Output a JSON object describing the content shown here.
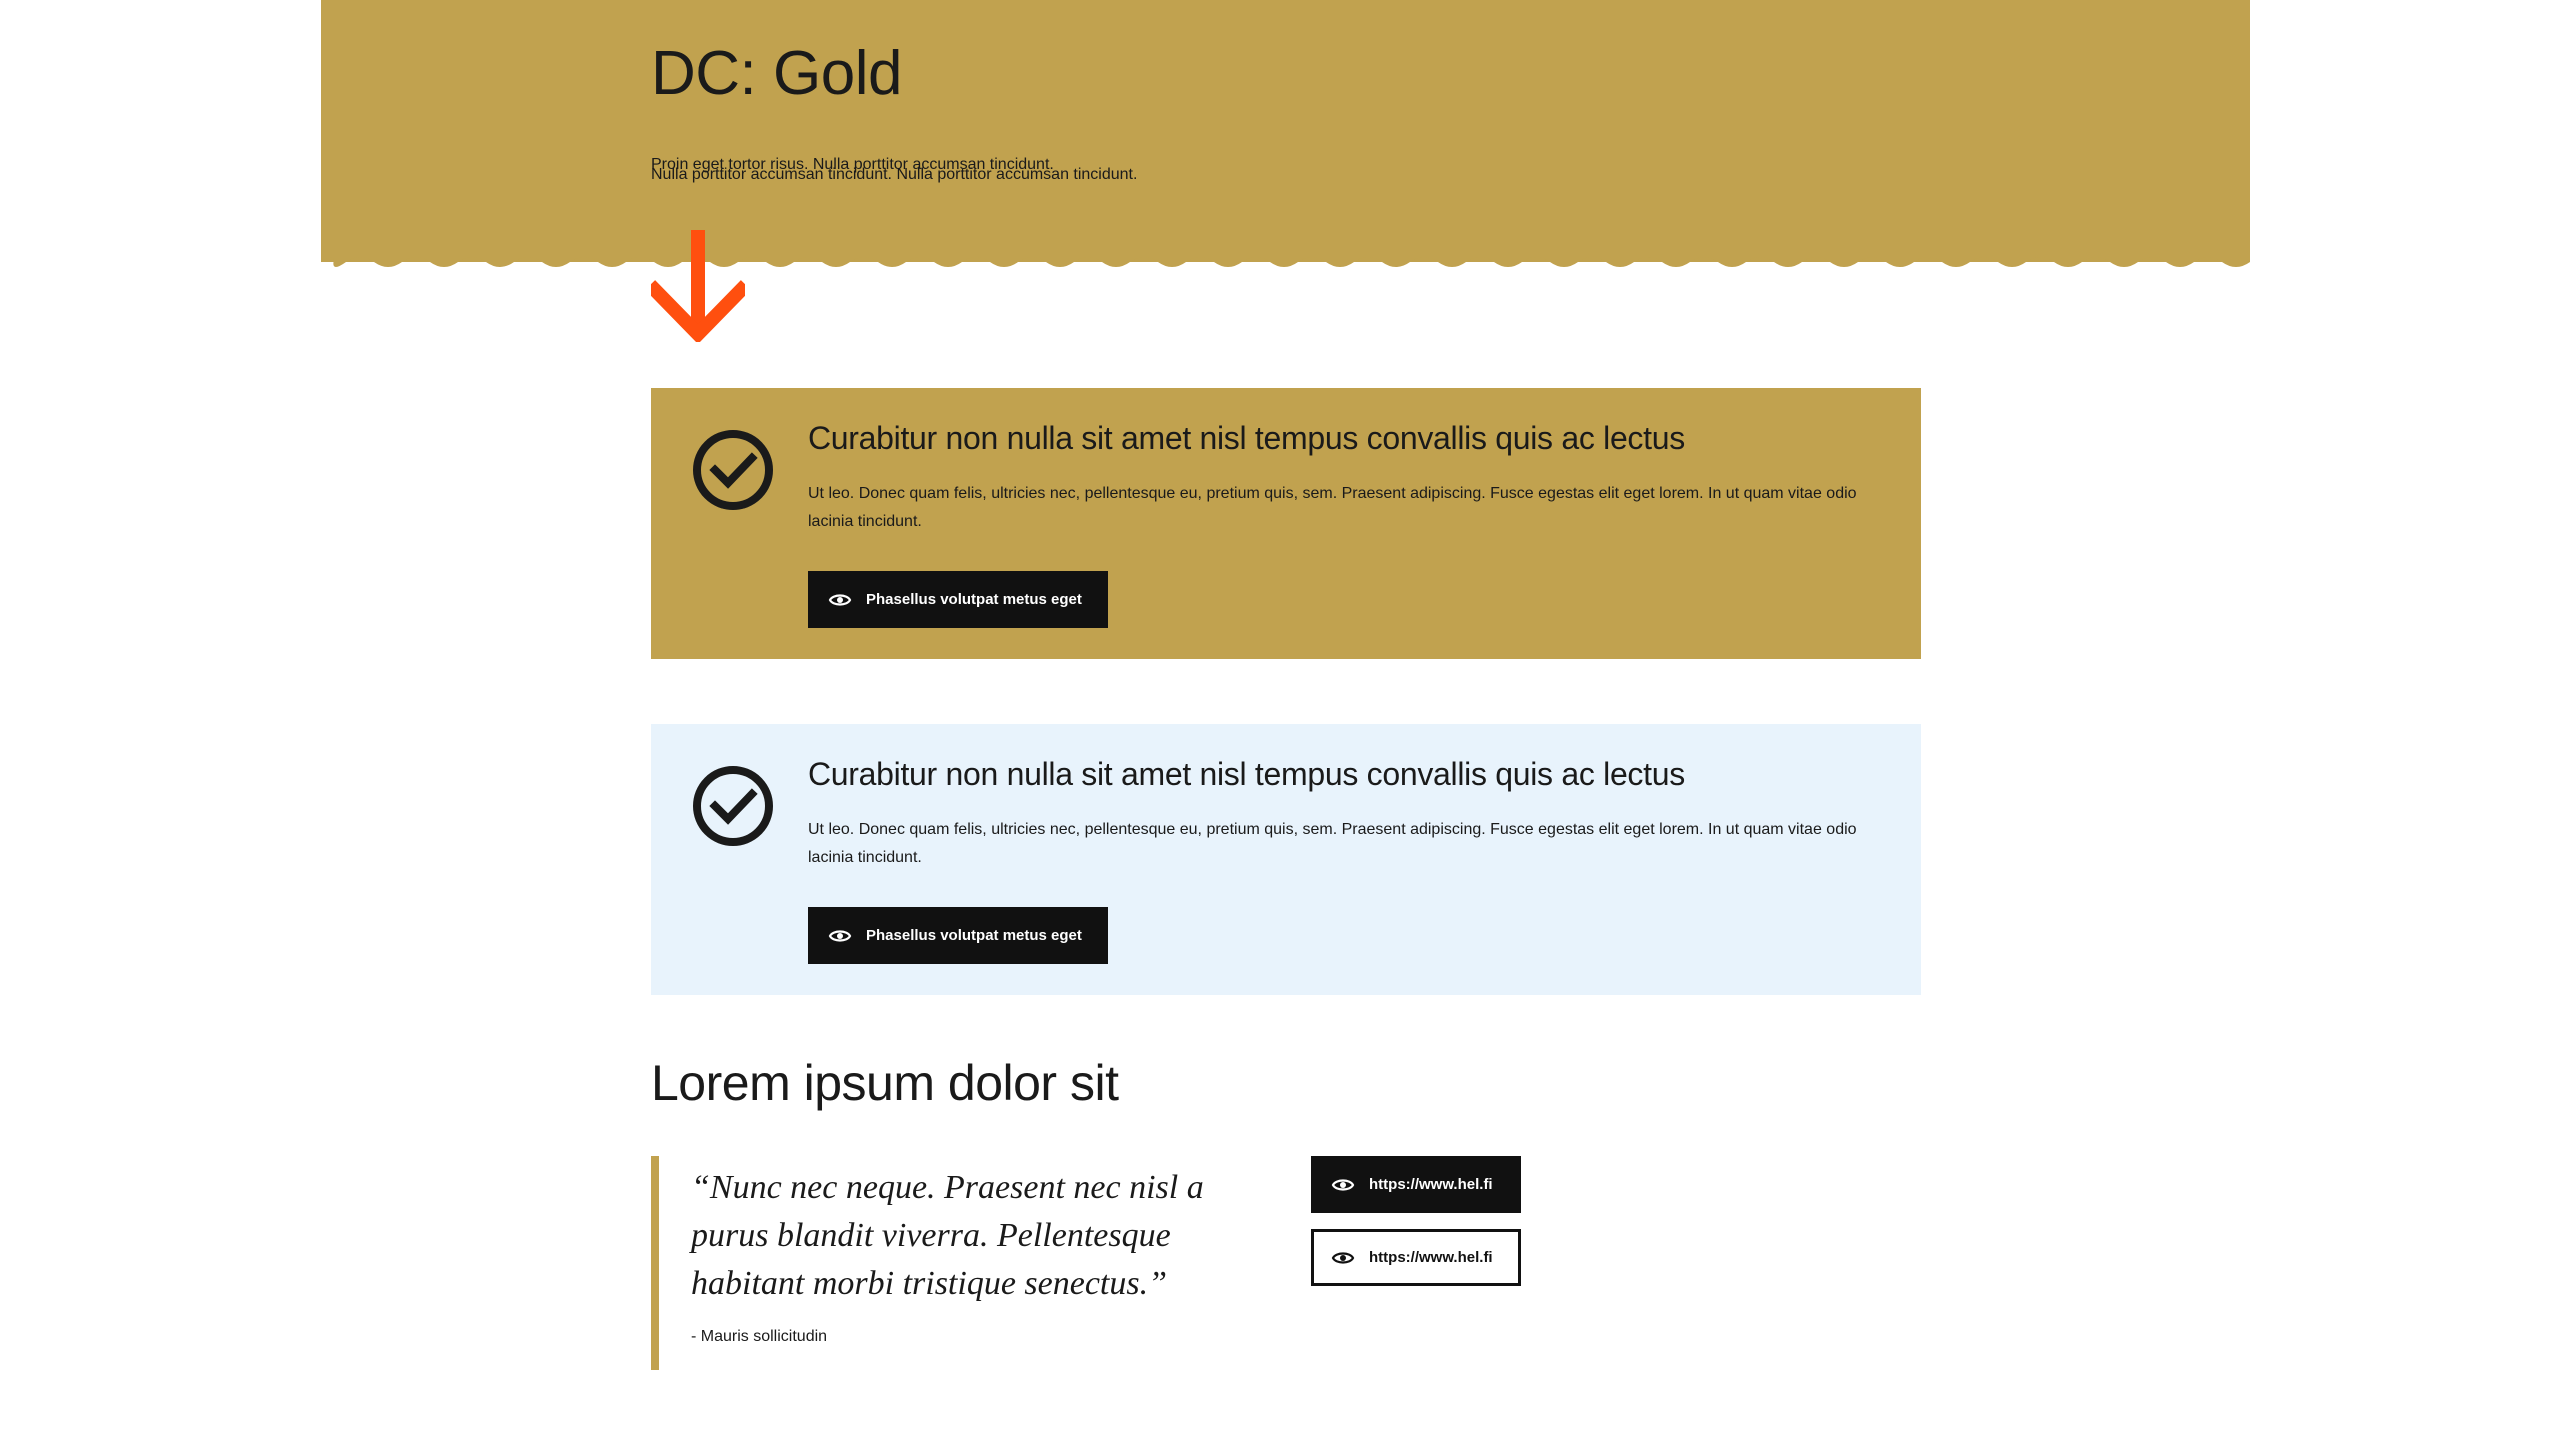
{
  "hero": {
    "title": "DC: Gold",
    "paragraph_1": "Nulla porttitor accumsan tincidunt. Nulla porttitor accumsan tincidunt.",
    "paragraph_2": "Proin eget tortor risus. Nulla porttitor accumsan tincidunt.",
    "background_color": "#c1a24f"
  },
  "arrow": {
    "icon": "arrow-down-icon",
    "color": "#ff4f0f"
  },
  "notifications": [
    {
      "style": "gold",
      "background_color": "#c1a24f",
      "icon": "check-circle-icon",
      "title": "Curabitur non nulla sit amet nisl tempus convallis quis ac lectus",
      "body": "Ut leo. Donec quam felis, ultricies nec, pellentesque eu, pretium quis, sem. Praesent adipiscing. Fusce egestas elit eget lorem. In ut quam vitae odio lacinia tincidunt.",
      "button_label": "Phasellus volutpat metus eget",
      "button_icon": "eye-icon"
    },
    {
      "style": "light-blue",
      "background_color": "#e8f3fc",
      "icon": "check-circle-icon",
      "title": "Curabitur non nulla sit amet nisl tempus convallis quis ac lectus",
      "body": "Ut leo. Donec quam felis, ultricies nec, pellentesque eu, pretium quis, sem. Praesent adipiscing. Fusce egestas elit eget lorem. In ut quam vitae odio lacinia tincidunt.",
      "button_label": "Phasellus volutpat metus eget",
      "button_icon": "eye-icon"
    }
  ],
  "section": {
    "title": "Lorem ipsum dolor sit",
    "quote": {
      "text": "“Nunc nec neque. Praesent nec nisl a purus blandit viverra. Pellentesque habitant morbi tristique senectus.”",
      "author": "- Mauris sollicitudin",
      "border_color": "#c1a24f"
    },
    "links": [
      {
        "label": "https://www.hel.fi",
        "variant": "primary",
        "icon": "eye-icon"
      },
      {
        "label": "https://www.hel.fi",
        "variant": "secondary",
        "icon": "eye-icon"
      }
    ]
  }
}
